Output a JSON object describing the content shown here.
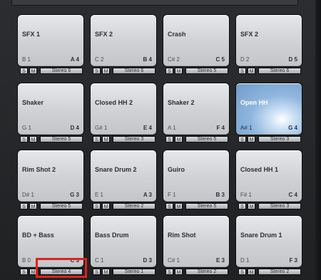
{
  "pads": [
    {
      "name": "SFX 1",
      "note": "B 1",
      "key": "A 4",
      "output": "Stereo 6",
      "active": false
    },
    {
      "name": "SFX 2",
      "note": "C 2",
      "key": "B 4",
      "output": "Stereo 6",
      "active": false
    },
    {
      "name": "Crash",
      "note": "C# 2",
      "key": "C 5",
      "output": "Stereo 5",
      "active": false
    },
    {
      "name": "SFX 2",
      "note": "D 2",
      "key": "D 5",
      "output": "Stereo 6",
      "active": false
    },
    {
      "name": "Shaker",
      "note": "G 1",
      "key": "D 4",
      "output": "Stereo 5",
      "active": false
    },
    {
      "name": "Closed HH 2",
      "note": "G# 1",
      "key": "E 4",
      "output": "Stereo 3",
      "active": false
    },
    {
      "name": "Shaker 2",
      "note": "A 1",
      "key": "F 4",
      "output": "Stereo 5",
      "active": false
    },
    {
      "name": "Open HH",
      "note": "A# 1",
      "key": "G 4",
      "output": "Stereo 3",
      "active": true
    },
    {
      "name": "Rim Shot 2",
      "note": "D# 1",
      "key": "G 3",
      "output": "Stereo 5",
      "active": false
    },
    {
      "name": "Snare Drum 2",
      "note": "E 1",
      "key": "A 3",
      "output": "Stereo 2",
      "active": false
    },
    {
      "name": "Guiro",
      "note": "F 1",
      "key": "B 3",
      "output": "Stereo 5",
      "active": false
    },
    {
      "name": "Closed HH 1",
      "note": "F# 1",
      "key": "C 4",
      "output": "Stereo 3",
      "active": false
    },
    {
      "name": "BD + Bass",
      "note": "B 0",
      "key": "C 3",
      "output": "Stereo 4",
      "active": false
    },
    {
      "name": "Bass Drum",
      "note": "C 1",
      "key": "D 3",
      "output": "Stereo 1",
      "active": false
    },
    {
      "name": "Rim Shot",
      "note": "C# 1",
      "key": "E 3",
      "output": "Stereo 2",
      "active": false
    },
    {
      "name": "Snare Drum 1",
      "note": "D 1",
      "key": "F 3",
      "output": "Stereo 2",
      "active": false
    }
  ],
  "labels": {
    "solo": "S",
    "mute": "M"
  },
  "colors": {
    "highlight": "#e0211c",
    "active_pad": "#8fb6de"
  }
}
